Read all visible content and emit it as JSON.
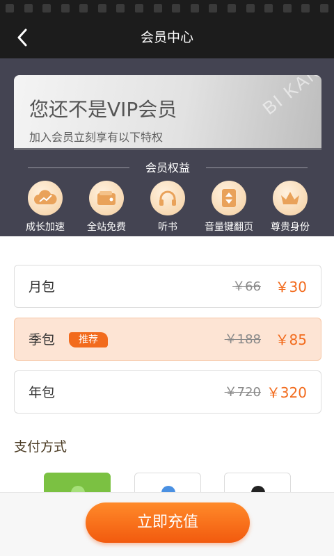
{
  "header": {
    "title": "会员中心"
  },
  "vip_card": {
    "title": "您还不是VIP会员",
    "subtitle": "加入会员立刻享有以下特权",
    "watermark": "BI KAN"
  },
  "benefits": {
    "heading": "会员权益",
    "items": [
      {
        "label": "成长加速",
        "icon": "growth-cloud-icon"
      },
      {
        "label": "全站免费",
        "icon": "wallet-icon"
      },
      {
        "label": "听书",
        "icon": "headphones-icon"
      },
      {
        "label": "音量键翻页",
        "icon": "volume-page-icon"
      },
      {
        "label": "尊贵身份",
        "icon": "crown-icon"
      }
    ]
  },
  "plans": [
    {
      "name": "月包",
      "original": "￥66",
      "price": "￥30",
      "badge": "",
      "selected": false
    },
    {
      "name": "季包",
      "original": "￥188",
      "price": "￥85",
      "badge": "推荐",
      "selected": true
    },
    {
      "name": "年包",
      "original": "￥720",
      "price": "￥320",
      "badge": "",
      "selected": false
    }
  ],
  "payment": {
    "title": "支付方式",
    "methods": [
      {
        "icon": "wechat-pay-icon",
        "selected": true
      },
      {
        "icon": "alipay-icon",
        "selected": false
      },
      {
        "icon": "other-pay-icon",
        "selected": false
      }
    ]
  },
  "action": {
    "recharge_label": "立即充值"
  },
  "colors": {
    "accent": "#f26b1d",
    "hero_bg": "#444452",
    "topbar_bg": "#1c1c1c",
    "selected_plan_bg": "#fde4d4",
    "wechat_green": "#7bc142"
  }
}
